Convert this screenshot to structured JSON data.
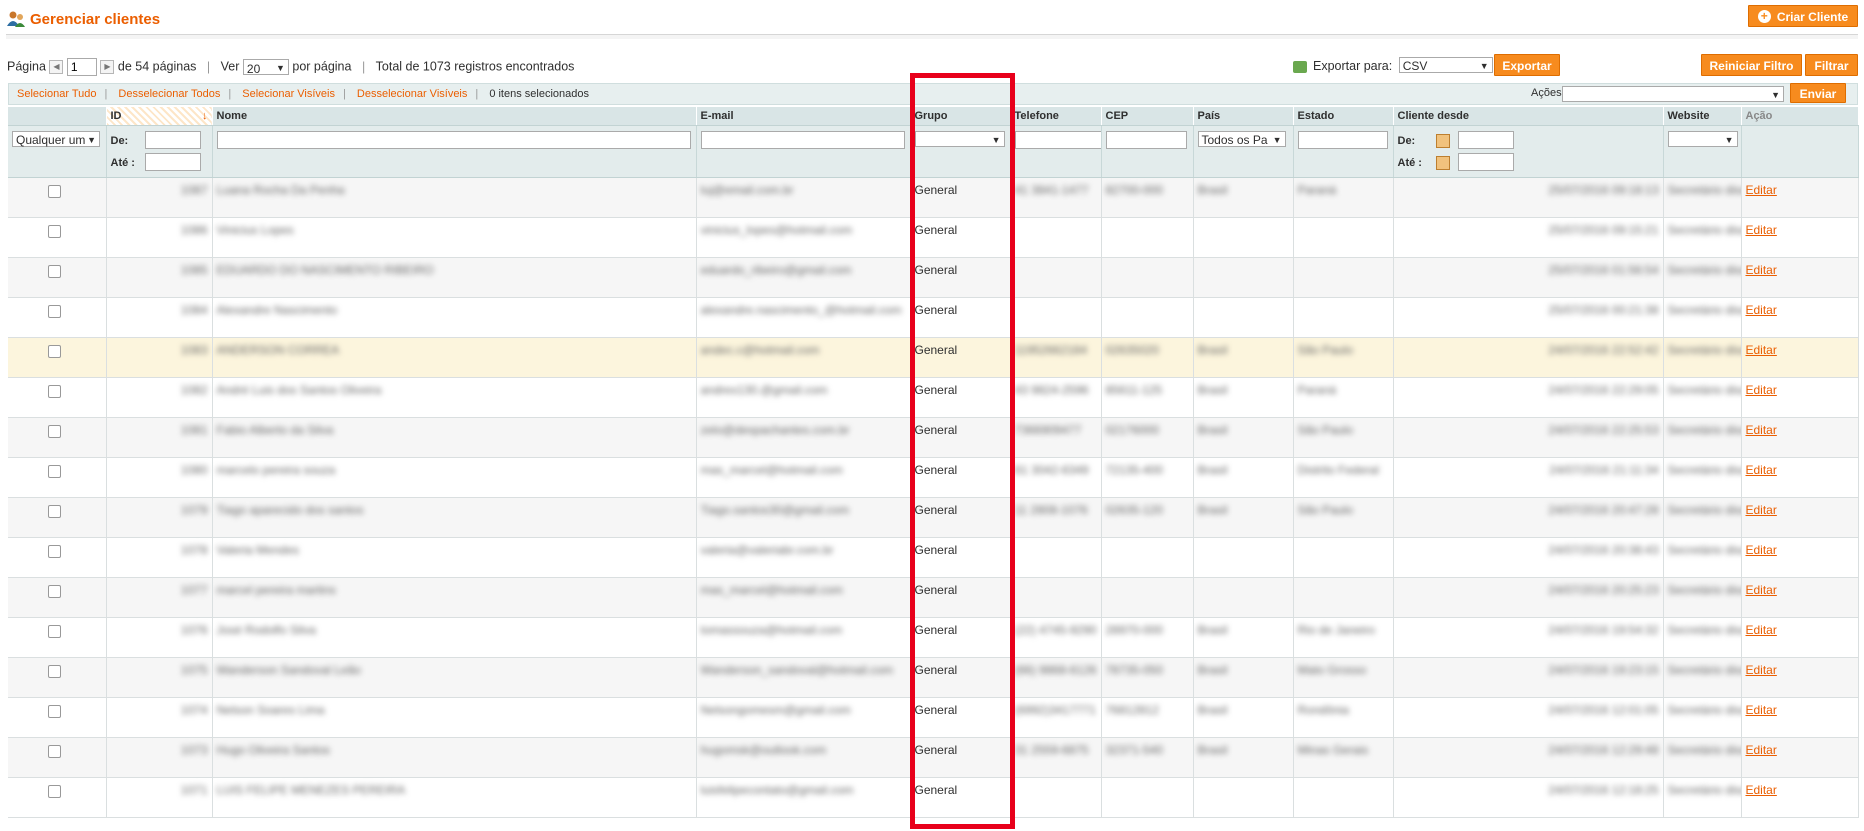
{
  "header": {
    "title": "Gerenciar clientes",
    "create_button": "Criar Cliente"
  },
  "pager": {
    "page_label": "Página",
    "current_page": "1",
    "of_pages": "de 54 páginas",
    "view_label": "Ver",
    "per_page": "20",
    "per_page_label": "por página",
    "total": "Total de 1073 registros encontrados"
  },
  "export": {
    "label": "Exportar para:",
    "format": "CSV",
    "button": "Exportar"
  },
  "actions": {
    "reset_filter": "Reiniciar Filtro",
    "filter": "Filtrar",
    "actions_label": "Ações",
    "submit": "Enviar"
  },
  "massaction": {
    "select_all": "Selecionar Tudo",
    "unselect_all": "Desselecionar Todos",
    "select_visible": "Selecionar Visíveis",
    "unselect_visible": "Desselecionar Visíveis",
    "selected_count": "0 itens selecionados"
  },
  "columns": [
    "ID",
    "Nome",
    "E-mail",
    "Grupo",
    "Telefone",
    "CEP",
    "País",
    "Estado",
    "Cliente desde",
    "Website",
    "Ação"
  ],
  "filters": {
    "any_option": "Qualquer um",
    "from_label": "De:",
    "to_label": "Até :",
    "country_option": "Todos os Pa"
  },
  "rows": [
    {
      "id": "1087",
      "name": "Luana Rocha Da Penha",
      "email": "luj@email.com.br",
      "group": "General",
      "phone": "41 3841-1477",
      "cep": "82700-000",
      "country": "Brasil",
      "state": "Paraná",
      "since": "25/07/2016 09:18:13",
      "website": "Secretário disaro",
      "action": "Editar"
    },
    {
      "id": "1086",
      "name": "Vinicius Lopes",
      "email": "vinicius_lopes@hotmail.com",
      "group": "General",
      "phone": "",
      "cep": "",
      "country": "",
      "state": "",
      "since": "25/07/2016 09:15:21",
      "website": "Secretário disaro",
      "action": "Editar"
    },
    {
      "id": "1085",
      "name": "EDUARDO DO NASCIMENTO RIBEIRO",
      "email": "eduardo_ribeiro@gmail.com",
      "group": "General",
      "phone": "",
      "cep": "",
      "country": "",
      "state": "",
      "since": "25/07/2016 01:56:54",
      "website": "Secretário disaro",
      "action": "Editar"
    },
    {
      "id": "1084",
      "name": "Alexandre Nascimento",
      "email": "alexandre.nascimento_@hotmail.com",
      "group": "General",
      "phone": "",
      "cep": "",
      "country": "",
      "state": "",
      "since": "25/07/2016 00:21:38",
      "website": "Secretário disaro",
      "action": "Editar"
    },
    {
      "id": "1083",
      "name": "ANDERSON CORREA",
      "email": "andec.c@hotmail.com",
      "group": "General",
      "phone": "11952662184",
      "cep": "02635020",
      "country": "Brasil",
      "state": "São Paulo",
      "since": "24/07/2016 22:52:42",
      "website": "Secretário disaro",
      "action": "Editar"
    },
    {
      "id": "1082",
      "name": "André Luis dos Santos Oliveira",
      "email": "andrex130.@gmail.com",
      "group": "General",
      "phone": "43 9824-2596",
      "cep": "85611-125",
      "country": "Brasil",
      "state": "Paraná",
      "since": "24/07/2016 22:29:05",
      "website": "Secretário disaro",
      "action": "Editar"
    },
    {
      "id": "1081",
      "name": "Fabio Alberto da Silva",
      "email": "zelo@despachantes.com.br",
      "group": "General",
      "phone": "7366909477",
      "cep": "02176000",
      "country": "Brasil",
      "state": "São Paulo",
      "since": "24/07/2016 22:25:53",
      "website": "Secretário disaro",
      "action": "Editar"
    },
    {
      "id": "1080",
      "name": "marcelo pereira souza",
      "email": "mas_marcel@hotmail.com",
      "group": "General",
      "phone": "61 3042-6349",
      "cep": "72135-400",
      "country": "Brasil",
      "state": "Distrito Federal",
      "since": "24/07/2016 21:11:34",
      "website": "Secretário disaro",
      "action": "Editar"
    },
    {
      "id": "1079",
      "name": "Tiago aparecido dos santos",
      "email": "Tiago.santos30@gmail.com",
      "group": "General",
      "phone": "11 2808-1076",
      "cep": "02635-120",
      "country": "Brasil",
      "state": "São Paulo",
      "since": "24/07/2016 20:47:28",
      "website": "Secretário disaro",
      "action": "Editar"
    },
    {
      "id": "1078",
      "name": "Valeria Mendes",
      "email": "valeria@valeriabr.com.br",
      "group": "General",
      "phone": "",
      "cep": "",
      "country": "",
      "state": "",
      "since": "24/07/2016 20:38:43",
      "website": "Secretário disaro",
      "action": "Editar"
    },
    {
      "id": "1077",
      "name": "marcel pereira martins",
      "email": "mas_marcel@hotmail.com",
      "group": "General",
      "phone": "",
      "cep": "",
      "country": "",
      "state": "",
      "since": "24/07/2016 20:25:23",
      "website": "Secretário disaro",
      "action": "Editar"
    },
    {
      "id": "1076",
      "name": "José Rodolfo Silva",
      "email": "tomassouza@hotmail.com",
      "group": "General",
      "phone": "(22) 4745-9290",
      "cep": "28970-000",
      "country": "Brasil",
      "state": "Rio de Janeiro",
      "since": "24/07/2016 19:54:32",
      "website": "Secretário disaro",
      "action": "Editar"
    },
    {
      "id": "1075",
      "name": "Wanderson Sandoval Leão",
      "email": "Wanderson_sandoval@hotmail.com",
      "group": "General",
      "phone": "(66) 9868-6126",
      "cep": "78735-050",
      "country": "Brasil",
      "state": "Mato Grosso",
      "since": "24/07/2016 19:23:15",
      "website": "Secretário disaro",
      "action": "Editar"
    },
    {
      "id": "1074",
      "name": "Nelson Soares Lima",
      "email": "Nelsongomesm@gmail.com",
      "group": "General",
      "phone": "(6992)3417771",
      "cep": "76812812",
      "country": "Brasil",
      "state": "Rondônia",
      "since": "24/07/2016 12:01:05",
      "website": "Secretário disaro",
      "action": "Editar"
    },
    {
      "id": "1073",
      "name": "Hugo Oliveira Santos",
      "email": "hugomsk@outlook.com",
      "group": "General",
      "phone": "31 2559-6875",
      "cep": "32371-540",
      "country": "Brasil",
      "state": "Minas Gerais",
      "since": "24/07/2016 12:29:48",
      "website": "Secretário disaro",
      "action": "Editar"
    },
    {
      "id": "1071",
      "name": "LUIS FELIPE MENEZES PEREIRA",
      "email": "luisfelipecontato@gmail.com",
      "group": "General",
      "phone": "",
      "cep": "",
      "country": "",
      "state": "",
      "since": "24/07/2016 12:18:25",
      "website": "Secretário disaro",
      "action": "Editar"
    }
  ],
  "colors": {
    "accent": "#eb5e00",
    "button": "#f78b1e",
    "highlight_box": "#e8001b",
    "header_bg": "#d9e5e6"
  }
}
